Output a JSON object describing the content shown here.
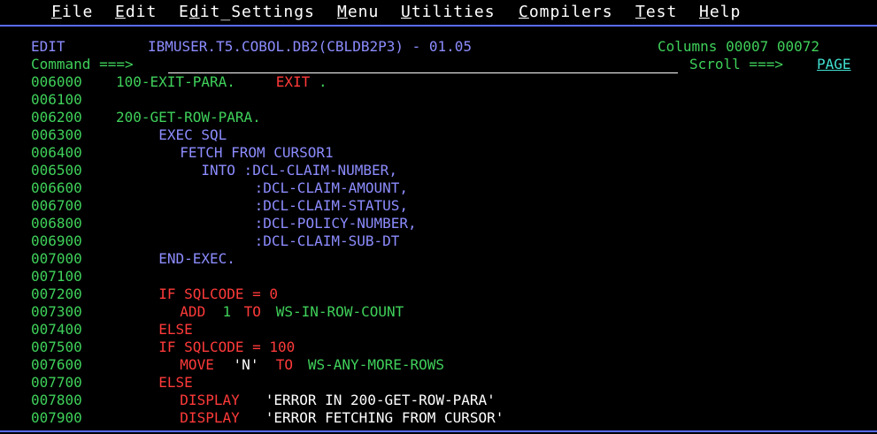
{
  "menu": [
    {
      "mnemonic": "F",
      "rest": "ile",
      "name": "menu-file"
    },
    {
      "mnemonic": "E",
      "rest": "dit",
      "name": "menu-edit"
    },
    {
      "pre": "E",
      "mnemonic": "d",
      "rest": "it_Settings",
      "name": "menu-edit-settings"
    },
    {
      "mnemonic": "M",
      "rest": "enu",
      "name": "menu-menu"
    },
    {
      "mnemonic": "U",
      "rest": "tilities",
      "name": "menu-utilities"
    },
    {
      "mnemonic": "C",
      "rest": "ompilers",
      "name": "menu-compilers"
    },
    {
      "mnemonic": "T",
      "rest": "est",
      "name": "menu-test"
    },
    {
      "mnemonic": "H",
      "rest": "elp",
      "name": "menu-help"
    }
  ],
  "header": {
    "mode": "EDIT",
    "dataset": "IBMUSER.T5.COBOL.DB2(CBLDB2P3) - 01.05",
    "columns": "Columns 00007 00072"
  },
  "command": {
    "label": "Command ===>",
    "value": "",
    "scroll_label": "Scroll ===>",
    "scroll_value": "PAGE"
  },
  "lines": [
    {
      "num": "006000",
      "segs": [
        {
          "t": "100-EXIT-PARA. ",
          "c": "green"
        },
        {
          "t": "EXIT",
          "c": "red"
        },
        {
          "t": ".",
          "c": "green"
        }
      ],
      "indent": 0
    },
    {
      "num": "006100",
      "segs": [],
      "indent": 0
    },
    {
      "num": "006200",
      "segs": [
        {
          "t": "200-GET-ROW-PARA.",
          "c": "green"
        }
      ],
      "indent": 0
    },
    {
      "num": "006300",
      "segs": [
        {
          "t": "EXEC SQL",
          "c": "blue"
        }
      ],
      "indent": 4
    },
    {
      "num": "006400",
      "segs": [
        {
          "t": "FETCH FROM CURSOR1",
          "c": "blue"
        }
      ],
      "indent": 6
    },
    {
      "num": "006500",
      "segs": [
        {
          "t": "INTO :DCL-CLAIM-NUMBER,",
          "c": "blue"
        }
      ],
      "indent": 8
    },
    {
      "num": "006600",
      "segs": [
        {
          "t": ":DCL-CLAIM-AMOUNT,",
          "c": "blue"
        }
      ],
      "indent": 13
    },
    {
      "num": "006700",
      "segs": [
        {
          "t": ":DCL-CLAIM-STATUS,",
          "c": "blue"
        }
      ],
      "indent": 13
    },
    {
      "num": "006800",
      "segs": [
        {
          "t": ":DCL-POLICY-NUMBER,",
          "c": "blue"
        }
      ],
      "indent": 13
    },
    {
      "num": "006900",
      "segs": [
        {
          "t": ":DCL-CLAIM-SUB-DT",
          "c": "blue"
        }
      ],
      "indent": 13
    },
    {
      "num": "007000",
      "segs": [
        {
          "t": "END-EXEC.",
          "c": "blue"
        }
      ],
      "indent": 4
    },
    {
      "num": "007100",
      "segs": [],
      "indent": 0
    },
    {
      "num": "007200",
      "segs": [
        {
          "t": "IF SQLCODE = 0",
          "c": "red"
        }
      ],
      "indent": 4
    },
    {
      "num": "007300",
      "segs": [
        {
          "t": "ADD ",
          "c": "red"
        },
        {
          "t": "1 ",
          "c": "green"
        },
        {
          "t": "TO ",
          "c": "red"
        },
        {
          "t": "WS-IN-ROW-COUNT",
          "c": "green"
        }
      ],
      "indent": 6
    },
    {
      "num": "007400",
      "segs": [
        {
          "t": "ELSE",
          "c": "red"
        }
      ],
      "indent": 4
    },
    {
      "num": "007500",
      "segs": [
        {
          "t": "IF SQLCODE = 100",
          "c": "red"
        }
      ],
      "indent": 4
    },
    {
      "num": "007600",
      "segs": [
        {
          "t": "MOVE ",
          "c": "red"
        },
        {
          "t": "'N' ",
          "c": "white"
        },
        {
          "t": "TO ",
          "c": "red"
        },
        {
          "t": "WS-ANY-MORE-ROWS",
          "c": "green"
        }
      ],
      "indent": 6
    },
    {
      "num": "007700",
      "segs": [
        {
          "t": "ELSE",
          "c": "red"
        }
      ],
      "indent": 4
    },
    {
      "num": "007800",
      "segs": [
        {
          "t": "DISPLAY ",
          "c": "red"
        },
        {
          "t": "'ERROR IN 200-GET-ROW-PARA'",
          "c": "white"
        }
      ],
      "indent": 6
    },
    {
      "num": "007900",
      "segs": [
        {
          "t": "DISPLAY ",
          "c": "red"
        },
        {
          "t": "'ERROR FETCHING FROM CURSOR'",
          "c": "white"
        }
      ],
      "indent": 6
    }
  ],
  "colors": {
    "background": "#000000",
    "blue": "#8c8cff",
    "green": "#3fd05a",
    "red": "#ff3a3a",
    "white": "#ffffff",
    "turquoise": "#40e0d0"
  }
}
